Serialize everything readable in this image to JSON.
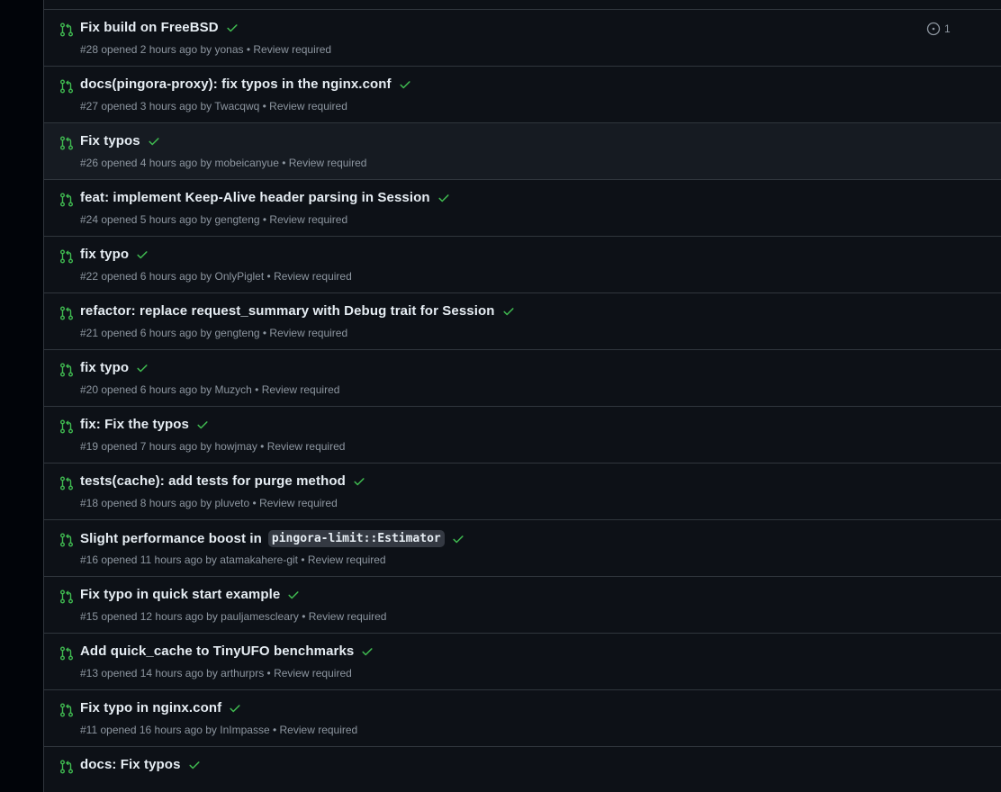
{
  "colors": {
    "open_icon": "#3fb950",
    "check": "#3fb950",
    "text_primary": "#e6edf3",
    "text_muted": "#8d96a0",
    "border": "#30363d"
  },
  "icons": {
    "status": "git-pull-request-icon",
    "checks": "check-icon",
    "issue": "issue-opened-icon"
  },
  "pull_requests": [
    {
      "title": "Fix build on FreeBSD",
      "number": "#28",
      "opened": "opened 2 hours ago by",
      "author": "yonas",
      "review": "Review required",
      "issues_count": "1"
    },
    {
      "title": "docs(pingora-proxy): fix typos in the nginx.conf",
      "number": "#27",
      "opened": "opened 3 hours ago by",
      "author": "Twacqwq",
      "review": "Review required"
    },
    {
      "title": "Fix typos",
      "number": "#26",
      "opened": "opened 4 hours ago by",
      "author": "mobeicanyue",
      "review": "Review required"
    },
    {
      "title": "feat: implement Keep-Alive header parsing in Session",
      "number": "#24",
      "opened": "opened 5 hours ago by",
      "author": "gengteng",
      "review": "Review required"
    },
    {
      "title": "fix typo",
      "number": "#22",
      "opened": "opened 6 hours ago by",
      "author": "OnlyPiglet",
      "review": "Review required"
    },
    {
      "title": "refactor: replace request_summary with Debug trait for Session",
      "number": "#21",
      "opened": "opened 6 hours ago by",
      "author": "gengteng",
      "review": "Review required"
    },
    {
      "title": "fix typo",
      "number": "#20",
      "opened": "opened 6 hours ago by",
      "author": "Muzych",
      "review": "Review required"
    },
    {
      "title": "fix: Fix the typos",
      "number": "#19",
      "opened": "opened 7 hours ago by",
      "author": "howjmay",
      "review": "Review required"
    },
    {
      "title": "tests(cache): add tests for purge method",
      "number": "#18",
      "opened": "opened 8 hours ago by",
      "author": "pluveto",
      "review": "Review required"
    },
    {
      "title": "Slight performance boost in",
      "code": "pingora-limit::Estimator",
      "number": "#16",
      "opened": "opened 11 hours ago by",
      "author": "atamakahere-git",
      "review": "Review required"
    },
    {
      "title": "Fix typo in quick start example",
      "number": "#15",
      "opened": "opened 12 hours ago by",
      "author": "pauljamescleary",
      "review": "Review required"
    },
    {
      "title": "Add quick_cache to TinyUFO benchmarks",
      "number": "#13",
      "opened": "opened 14 hours ago by",
      "author": "arthurprs",
      "review": "Review required"
    },
    {
      "title": "Fix typo in nginx.conf",
      "number": "#11",
      "opened": "opened 16 hours ago by",
      "author": "InImpasse",
      "review": "Review required"
    },
    {
      "title": "docs: Fix typos",
      "number": "",
      "opened": "",
      "author": "",
      "review": ""
    }
  ]
}
